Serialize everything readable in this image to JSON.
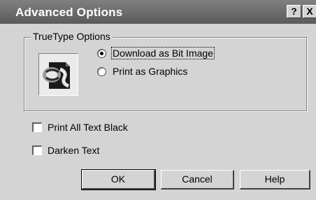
{
  "window": {
    "title": "Advanced Options",
    "help_glyph": "?",
    "close_glyph": "X"
  },
  "truetype": {
    "legend": "TrueType Options",
    "options": [
      {
        "label": "Download as Bit Image",
        "selected": true
      },
      {
        "label": "Print as Graphics",
        "selected": false
      }
    ]
  },
  "checkboxes": [
    {
      "label": "Print All Text Black",
      "checked": false
    },
    {
      "label": "Darken Text",
      "checked": false
    }
  ],
  "buttons": {
    "ok": "OK",
    "cancel": "Cancel",
    "help": "Help"
  },
  "icons": {
    "truetype": "truetype-font-icon"
  }
}
